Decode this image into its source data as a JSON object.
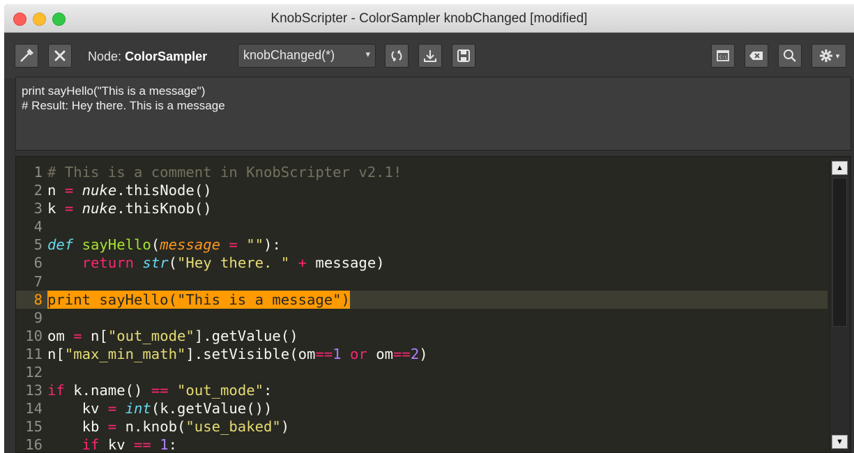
{
  "window": {
    "title": "KnobScripter - ColorSampler knobChanged [modified]"
  },
  "toolbar": {
    "node_prefix": "Node:",
    "node_name": "ColorSampler",
    "knob_select": "knobChanged(*)",
    "select_arrow": "▾",
    "icons": [
      "pick-knob-icon",
      "close-icon",
      "reload-icon",
      "load-icon",
      "save-icon",
      "console-icon",
      "clear-console-icon",
      "search-icon",
      "gear-icon"
    ]
  },
  "console": {
    "lines": [
      "print sayHello(\"This is a message\")",
      "# Result: Hey there. This is a message"
    ]
  },
  "editor": {
    "current_line": 8,
    "lines": [
      {
        "n": "1",
        "text": "# This is a comment in KnobScripter v2.1!"
      },
      {
        "n": "2",
        "text": "n = nuke.thisNode()"
      },
      {
        "n": "3",
        "text": "k = nuke.thisKnob()"
      },
      {
        "n": "4",
        "text": ""
      },
      {
        "n": "5",
        "text": "def sayHello(message = \"\"):"
      },
      {
        "n": "6",
        "text": "    return str(\"Hey there. \" + message)"
      },
      {
        "n": "7",
        "text": ""
      },
      {
        "n": "8",
        "text": "print sayHello(\"This is a message\")"
      },
      {
        "n": "9",
        "text": ""
      },
      {
        "n": "10",
        "text": "om = n[\"out_mode\"].getValue()"
      },
      {
        "n": "11",
        "text": "n[\"max_min_math\"].setVisible(om==1 or om==2)"
      },
      {
        "n": "12",
        "text": ""
      },
      {
        "n": "13",
        "text": "if k.name() == \"out_mode\":"
      },
      {
        "n": "14",
        "text": "    kv = int(k.getValue())"
      },
      {
        "n": "15",
        "text": "    kb = n.knob(\"use_baked\")"
      },
      {
        "n": "16",
        "text": "    if kv == 1:"
      }
    ]
  },
  "scrollbar": {
    "up_arrow": "▲",
    "down_arrow": "▼",
    "position": 0.0
  }
}
